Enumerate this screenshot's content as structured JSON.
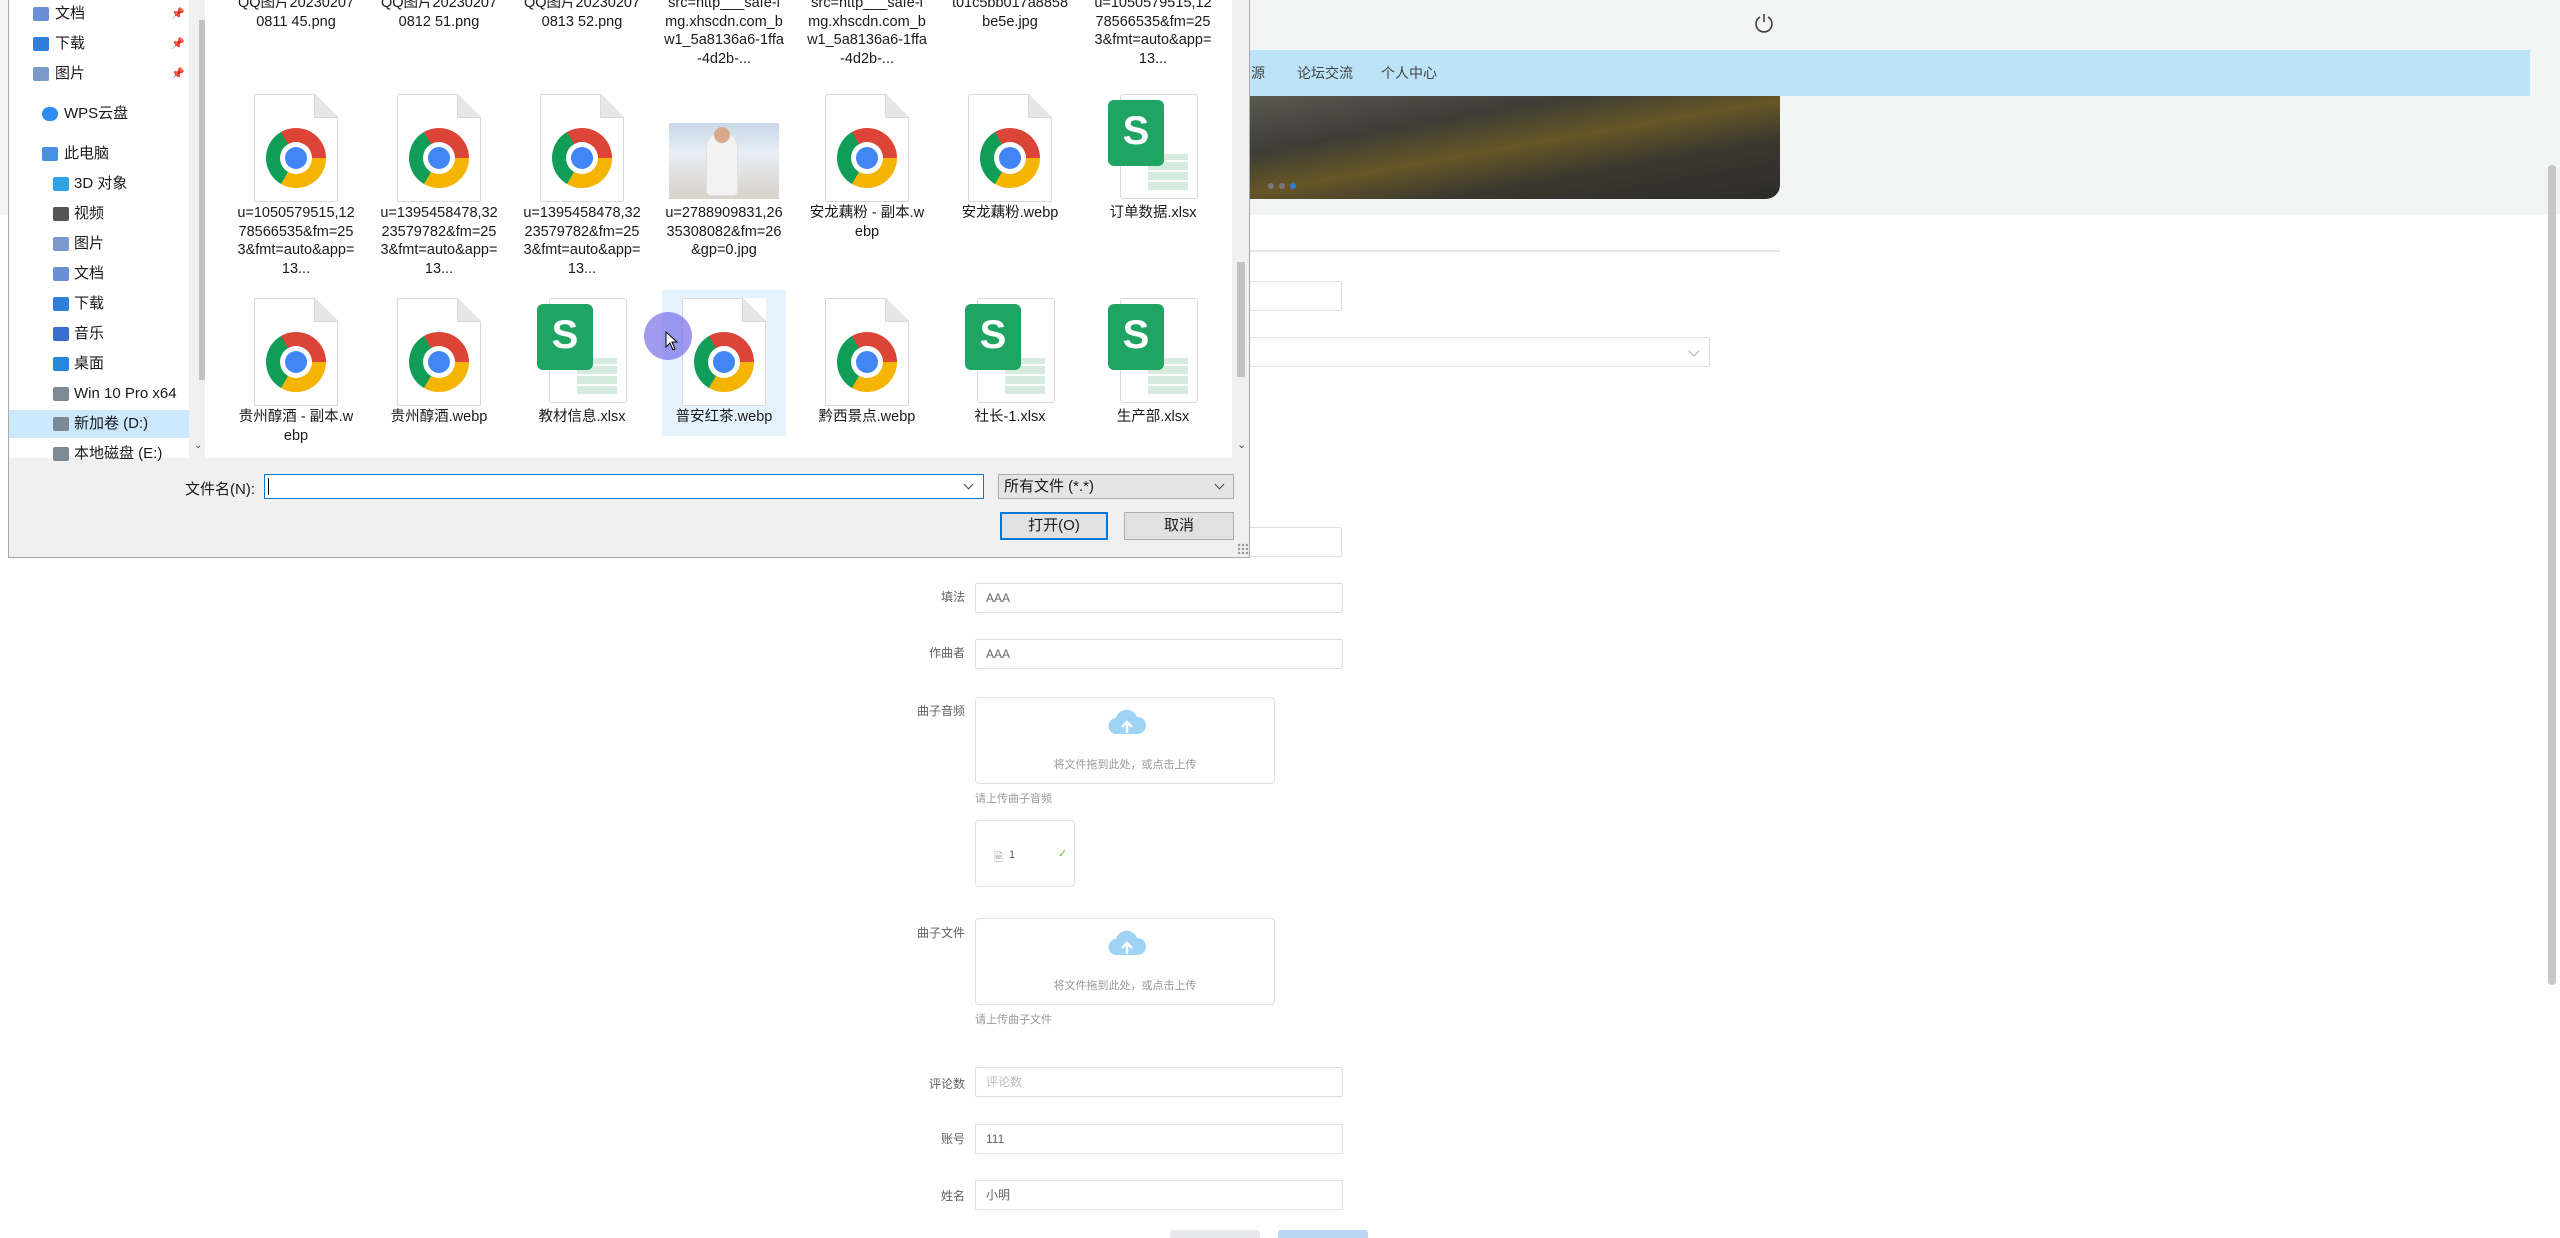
{
  "web": {
    "nav": [
      "源",
      "论坛交流",
      "个人中心"
    ],
    "form": {
      "lyricist_label": "填法",
      "lyricist_value": "AAA",
      "composer_label": "作曲者",
      "composer_value": "AAA",
      "audio_label": "曲子音频",
      "audio_upload_text": "将文件拖到此处，或点击上传",
      "audio_tip": "请上传曲子音频",
      "uploaded_file": "1",
      "file_label": "曲子文件",
      "file_upload_text": "将文件拖到此处，或点击上传",
      "file_tip": "请上传曲子文件",
      "comments_label": "评论数",
      "comments_placeholder": "评论数",
      "account_label": "账号",
      "account_value": "111",
      "name_label": "姓名",
      "name_value": "小明"
    },
    "colors": {
      "nav": "#bde3f8",
      "accent": "#2b7fd8"
    }
  },
  "dialog": {
    "nav_items": [
      {
        "label": "文档",
        "icon": "document-folder-icon",
        "pinned": true
      },
      {
        "label": "下载",
        "icon": "download-folder-icon",
        "pinned": true
      },
      {
        "label": "图片",
        "icon": "pictures-folder-icon",
        "pinned": true
      },
      {
        "label": "WPS云盘",
        "icon": "cloud-icon",
        "pinned": false
      },
      {
        "label": "此电脑",
        "icon": "computer-icon",
        "pinned": false
      },
      {
        "label": "3D 对象",
        "icon": "3d-objects-icon",
        "pinned": false
      },
      {
        "label": "视频",
        "icon": "videos-folder-icon",
        "pinned": false
      },
      {
        "label": "图片",
        "icon": "pictures-folder-icon",
        "pinned": false
      },
      {
        "label": "文档",
        "icon": "document-folder-icon",
        "pinned": false
      },
      {
        "label": "下载",
        "icon": "download-folder-icon",
        "pinned": false
      },
      {
        "label": "音乐",
        "icon": "music-folder-icon",
        "pinned": false
      },
      {
        "label": "桌面",
        "icon": "desktop-folder-icon",
        "pinned": false
      },
      {
        "label": "Win 10 Pro x64",
        "icon": "drive-icon",
        "pinned": false
      },
      {
        "label": "新加卷 (D:)",
        "icon": "drive-icon",
        "pinned": false,
        "selected": true
      },
      {
        "label": "本地磁盘 (E:)",
        "icon": "drive-icon",
        "pinned": false
      }
    ],
    "files": [
      {
        "name": "QQ图片202302070811 45.png",
        "type": "none"
      },
      {
        "name": "QQ图片202302070812 51.png",
        "type": "none"
      },
      {
        "name": "QQ图片202302070813 52.png",
        "type": "none"
      },
      {
        "name": "src=http___safe-img.xhscdn.com_bw1_5a8136a6-1ffa-4d2b-...",
        "type": "none"
      },
      {
        "name": "src=http___safe-img.xhscdn.com_bw1_5a8136a6-1ffa-4d2b-...",
        "type": "none"
      },
      {
        "name": "t01c5bb017a8858be5e.jpg",
        "type": "none"
      },
      {
        "name": "u=1050579515,1278566535&fm=253&fmt=auto&app=13...",
        "type": "none"
      },
      {
        "name": "u=1050579515,1278566535&fm=253&fmt=auto&app=13...",
        "type": "chrome"
      },
      {
        "name": "u=1395458478,3223579782&fm=253&fmt=auto&app=13...",
        "type": "chrome"
      },
      {
        "name": "u=1395458478,3223579782&fm=253&fmt=auto&app=13...",
        "type": "chrome"
      },
      {
        "name": "u=2788909831,2635308082&fm=26&gp=0.jpg",
        "type": "photo"
      },
      {
        "name": "安龙藕粉 - 副本.webp",
        "type": "chrome"
      },
      {
        "name": "安龙藕粉.webp",
        "type": "chrome"
      },
      {
        "name": "订单数据.xlsx",
        "type": "xlsx"
      },
      {
        "name": "贵州醇酒 - 副本.webp",
        "type": "chrome"
      },
      {
        "name": "贵州醇酒.webp",
        "type": "chrome"
      },
      {
        "name": "教材信息.xlsx",
        "type": "xlsx"
      },
      {
        "name": "普安红茶.webp",
        "type": "chrome"
      },
      {
        "name": "黔西景点.webp",
        "type": "chrome"
      },
      {
        "name": "社长-1.xlsx",
        "type": "xlsx"
      },
      {
        "name": "生产部.xlsx",
        "type": "xlsx"
      }
    ],
    "filename_label": "文件名(N):",
    "filename_value": "",
    "filetype_value": "所有文件 (*.*)",
    "open_button": "打开(O)",
    "cancel_button": "取消"
  }
}
